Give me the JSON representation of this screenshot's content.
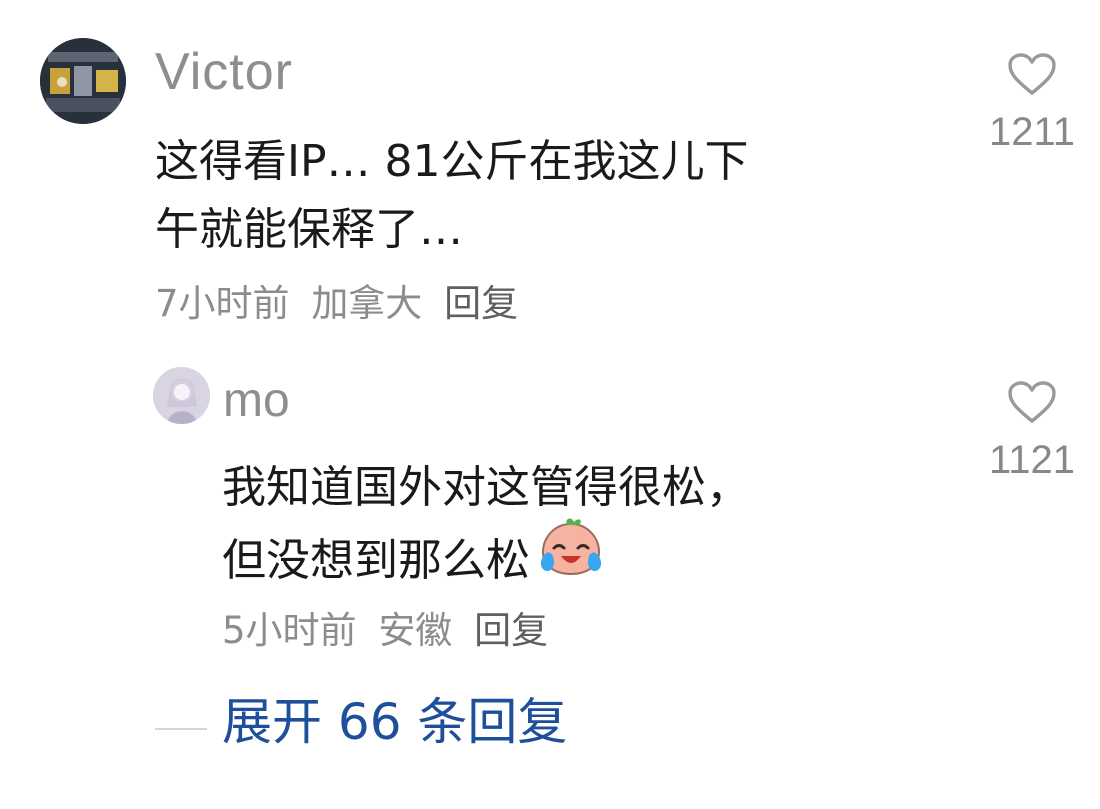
{
  "comments": [
    {
      "username": "Victor",
      "content_lines": [
        "这得看IP… 81公斤在我这儿下",
        "午就能保释了…"
      ],
      "time": "7小时前",
      "location": "加拿大",
      "reply_label": "回复",
      "likes": "1211"
    },
    {
      "username": "mo",
      "content_lines": [
        "我知道国外对这管得很松，",
        "但没想到那么松"
      ],
      "emoji_icon": "crying-laughing-emoji-icon",
      "time": "5小时前",
      "location": "安徽",
      "reply_label": "回复",
      "likes": "1121"
    }
  ],
  "expand_replies_label": "展开 66 条回复",
  "colors": {
    "username": "#8e8e8e",
    "meta": "#8c8c8c",
    "link_blue": "#1d4f9a"
  }
}
